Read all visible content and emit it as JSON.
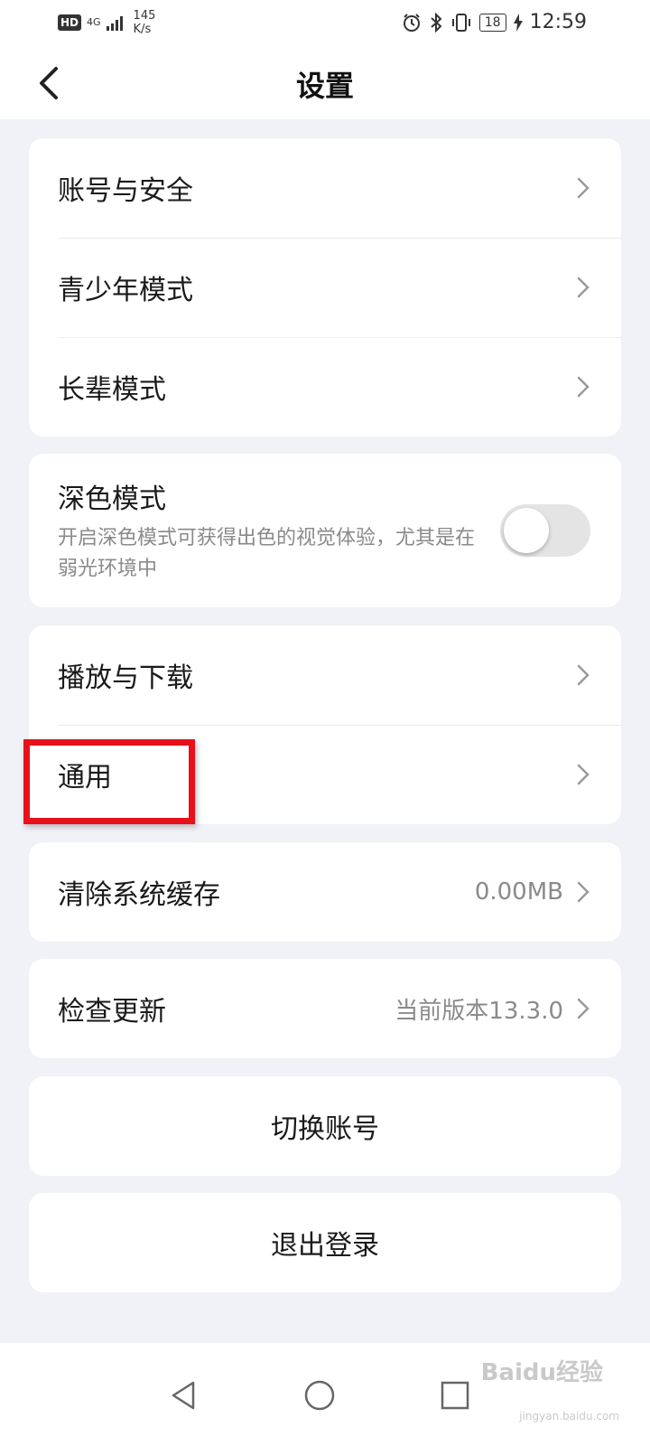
{
  "status_bar": {
    "hd": "HD",
    "network": "4G",
    "speed_value": "145",
    "speed_unit": "K/s",
    "battery": "18",
    "time": "12:59"
  },
  "header": {
    "title": "设置"
  },
  "groups": {
    "account": [
      {
        "label": "账号与安全"
      },
      {
        "label": "青少年模式"
      },
      {
        "label": "长辈模式"
      }
    ],
    "dark_mode": {
      "title": "深色模式",
      "description": "开启深色模式可获得出色的视觉体验，尤其是在弱光环境中",
      "enabled": false
    },
    "general": [
      {
        "label": "播放与下载"
      },
      {
        "label": "通用"
      }
    ],
    "cache": {
      "label": "清除系统缓存",
      "value": "0.00MB"
    },
    "update": {
      "label": "检查更新",
      "value": "当前版本13.3.0"
    },
    "switch_account": {
      "label": "切换账号"
    },
    "logout": {
      "label": "退出登录"
    }
  },
  "watermark": {
    "text": "Baidu经验",
    "url": "jingyan.baidu.com"
  },
  "colors": {
    "background": "#f0f2f7",
    "highlight": "#e8101a",
    "card": "#ffffff"
  }
}
